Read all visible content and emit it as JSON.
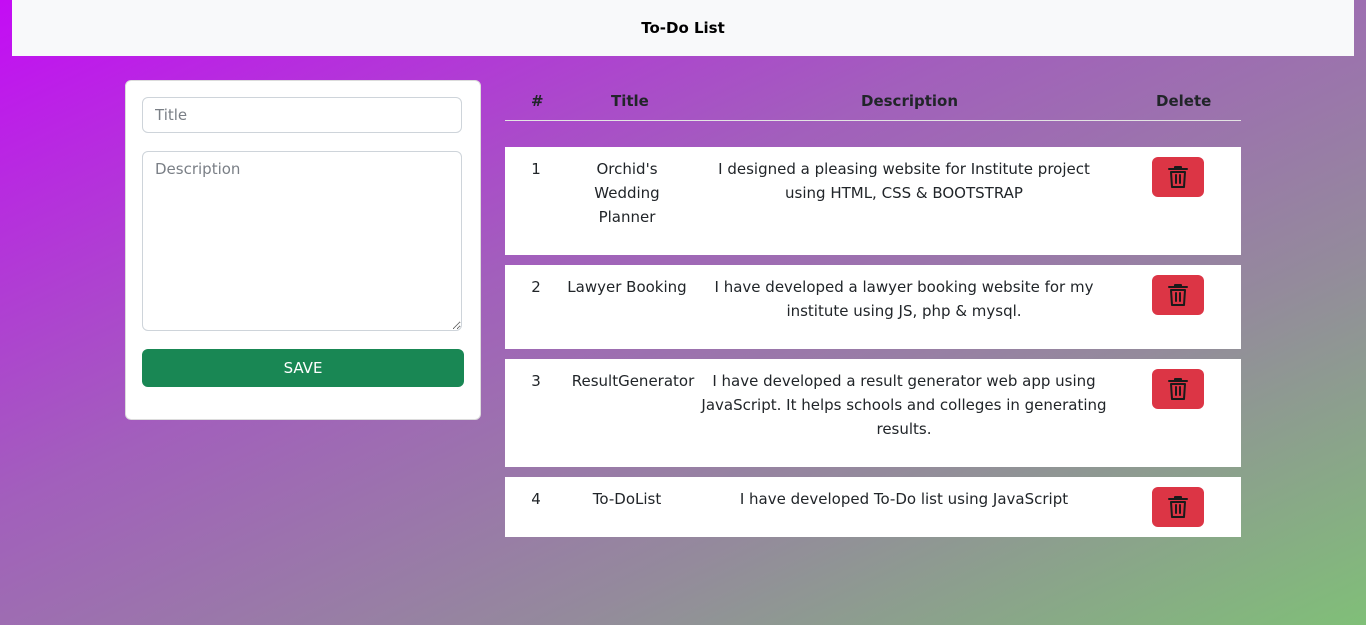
{
  "navbar": {
    "brand": "To-Do List"
  },
  "form": {
    "title_placeholder": "Title",
    "description_placeholder": "Description",
    "save_label": "SAVE"
  },
  "table": {
    "headers": {
      "num": "#",
      "title": "Title",
      "description": "Description",
      "delete": "Delete"
    },
    "rows": [
      {
        "num": "1",
        "title": "Orchid's Wedding Planner",
        "description": "I designed a pleasing website for Institute project using HTML, CSS & BOOTSTRAP",
        "delete_icon": "trash-icon"
      },
      {
        "num": "2",
        "title": "Lawyer Booking",
        "description": "I have developed a lawyer booking website for my institute using JS, php & mysql.",
        "delete_icon": "trash-icon"
      },
      {
        "num": "3",
        "title": "ResultGenerator",
        "description": "I have developed a result generator web app using JavaScript. It helps schools and colleges in generating results.",
        "delete_icon": "trash-icon"
      },
      {
        "num": "4",
        "title": "To-DoList",
        "description": "I have developed To-Do list using JavaScript",
        "delete_icon": "trash-icon"
      }
    ]
  },
  "colors": {
    "save": "#198754",
    "delete": "#dc3545",
    "navbar": "#f8f9fa"
  }
}
